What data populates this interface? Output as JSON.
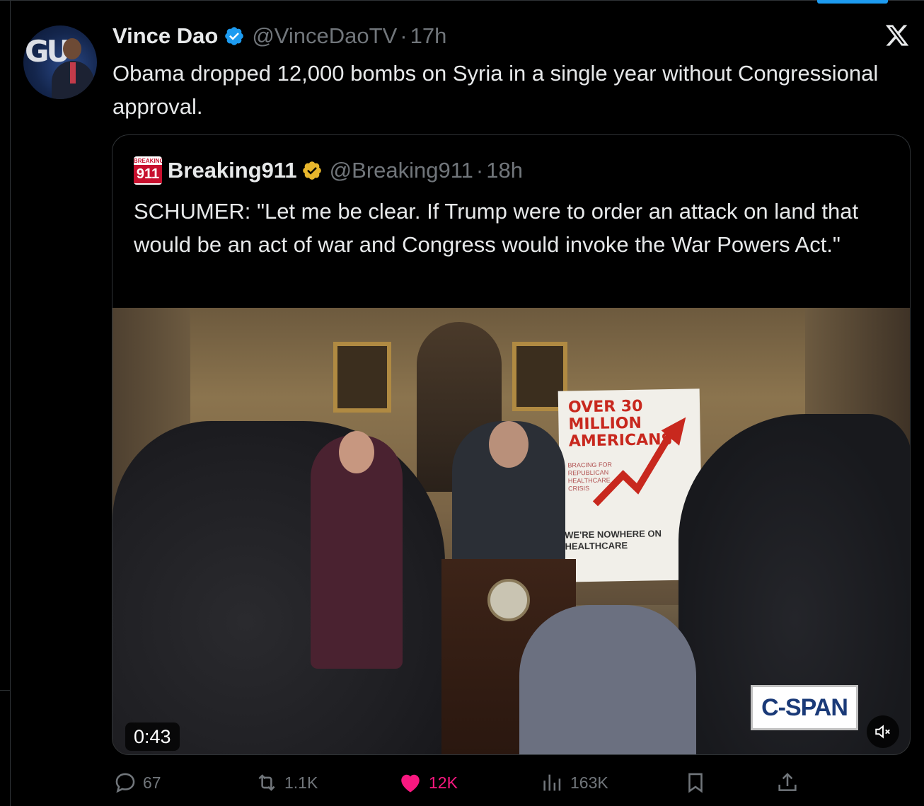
{
  "tweet": {
    "author_name": "Vince Dao",
    "author_handle": "@VinceDaoTV",
    "separator": "·",
    "time": "17h",
    "text": "Obama dropped 12,000 bombs on Syria in a single year without Congressional approval."
  },
  "quoted": {
    "author_name": "Breaking911",
    "author_handle": "@Breaking911",
    "separator": "·",
    "time": "18h",
    "text": "SCHUMER: \"Let me be clear. If Trump were to order an attack on land that would be an act of war and Congress would invoke the War Powers Act.\"",
    "avatar_top_label": "BREAKING",
    "avatar_bottom_label": "911",
    "video": {
      "duration": "0:43",
      "watermark": "C-SPAN",
      "sign_headline": "OVER 30 MILLION AMERICANS",
      "sign_sub": "BRACING FOR REPUBLICAN HEALTHCARE CRISIS",
      "sign_footer": "WE'RE NOWHERE ON HEALTHCARE"
    }
  },
  "actions": {
    "replies": "67",
    "reposts": "1.1K",
    "likes": "12K",
    "views": "163K"
  },
  "icons": [
    "verified-badge-icon",
    "x-logo-icon",
    "reply-icon",
    "repost-icon",
    "like-icon",
    "views-icon",
    "bookmark-icon",
    "share-icon",
    "mute-icon"
  ],
  "colors": {
    "background": "#000000",
    "text": "#e7e9ea",
    "secondary": "#71767b",
    "accent": "#1d9bf0",
    "like": "#f91880",
    "gold_verified": "#e8b62c"
  }
}
